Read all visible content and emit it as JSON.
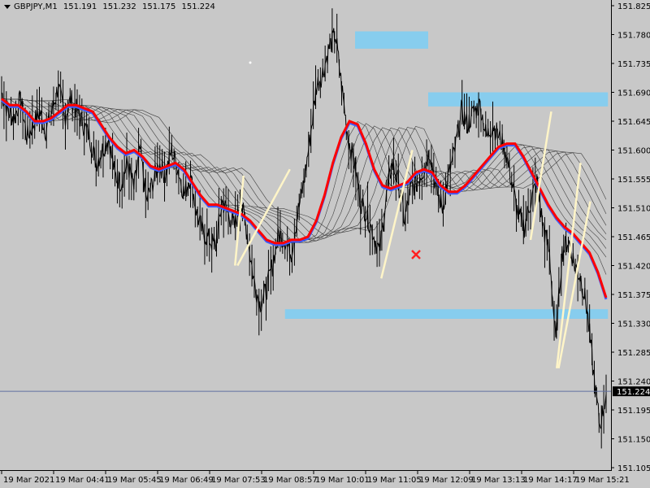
{
  "header": {
    "symbol": "GBPJPY,M1",
    "open": "151.191",
    "high": "151.232",
    "low": "151.175",
    "close": "151.224"
  },
  "colors": {
    "background": "#c8c8c8",
    "price_line": "#000000",
    "ma_main": "#ff0000",
    "ma_secondary": "#3b5cff",
    "ma_ribbon": "#404040",
    "zone": "#87cdee",
    "trend_lines": "#fff5c8",
    "marker": "#ff2020",
    "current_price_line": "#6070a0"
  },
  "chart_data": {
    "type": "line",
    "title": "GBPJPY,M1",
    "ylim": [
      151.13,
      151.83
    ],
    "y_ticks": [
      "151.825",
      "151.780",
      "151.735",
      "151.690",
      "151.645",
      "151.600",
      "151.555",
      "151.510",
      "151.465",
      "151.420",
      "151.375",
      "151.330",
      "151.285",
      "151.240",
      "151.195",
      "151.150",
      "151.105"
    ],
    "current_price": "151.224",
    "x_ticks": [
      "19 Mar 2021",
      "19 Mar 04:41",
      "19 Mar 05:45",
      "19 Mar 06:49",
      "19 Mar 07:53",
      "19 Mar 08:57",
      "19 Mar 10:01",
      "19 Mar 11:05",
      "19 Mar 12:09",
      "19 Mar 13:13",
      "19 Mar 14:17",
      "19 Mar 15:21"
    ],
    "price_series": {
      "name": "",
      "values": [
        151.69,
        151.66,
        151.65,
        151.68,
        151.62,
        151.64,
        151.66,
        151.63,
        151.66,
        151.7,
        151.65,
        151.68,
        151.66,
        151.64,
        151.62,
        151.58,
        151.6,
        151.62,
        151.56,
        151.55,
        151.58,
        151.54,
        151.6,
        151.52,
        151.55,
        151.58,
        151.56,
        151.6,
        151.57,
        151.53,
        151.56,
        151.5,
        151.47,
        151.46,
        151.45,
        151.52,
        151.5,
        151.48,
        151.52,
        151.47,
        151.4,
        151.36,
        151.38,
        151.42,
        151.47,
        151.46,
        151.44,
        151.5,
        151.55,
        151.62,
        151.7,
        151.72,
        151.76,
        151.78,
        151.7,
        151.62,
        151.58,
        151.52,
        151.5,
        151.47,
        151.44,
        151.52,
        151.58,
        151.55,
        151.49,
        151.54,
        151.55,
        151.57,
        151.6,
        151.54,
        151.51,
        151.56,
        151.6,
        151.66,
        151.64,
        151.66,
        151.67,
        151.62,
        151.64,
        151.62,
        151.6,
        151.55,
        151.5,
        151.48,
        151.52,
        151.55,
        151.48,
        151.44,
        151.3,
        151.44,
        151.46,
        151.42,
        151.4,
        151.35,
        151.25,
        151.17,
        151.22
      ]
    },
    "ma_series": {
      "name": "",
      "values": [
        151.68,
        151.67,
        151.67,
        151.66,
        151.645,
        151.645,
        151.65,
        151.66,
        151.67,
        151.67,
        151.665,
        151.66,
        151.64,
        151.62,
        151.605,
        151.595,
        151.6,
        151.59,
        151.575,
        151.57,
        151.575,
        151.58,
        151.57,
        151.55,
        151.53,
        151.515,
        151.515,
        151.51,
        151.505,
        151.5,
        151.49,
        151.475,
        151.46,
        151.455,
        151.455,
        151.46,
        151.46,
        151.465,
        151.49,
        151.53,
        151.58,
        151.62,
        151.645,
        151.64,
        151.61,
        151.57,
        151.545,
        151.54,
        151.545,
        151.55,
        151.565,
        151.57,
        151.565,
        151.545,
        151.535,
        151.535,
        151.545,
        151.56,
        151.575,
        151.59,
        151.605,
        151.61,
        151.61,
        151.59,
        151.565,
        151.54,
        151.515,
        151.495,
        151.48,
        151.47,
        151.455,
        151.44,
        151.41,
        151.37
      ]
    },
    "zones": [
      {
        "from_time_frac": 0.58,
        "to_time_frac": 0.7,
        "low": 151.758,
        "high": 151.785
      },
      {
        "from_time_frac": 0.7,
        "to_time_frac": 0.995,
        "low": 151.668,
        "high": 151.69
      },
      {
        "from_time_frac": 0.465,
        "to_time_frac": 0.995,
        "low": 151.337,
        "high": 151.352
      }
    ],
    "grid": false,
    "legend": "none"
  }
}
